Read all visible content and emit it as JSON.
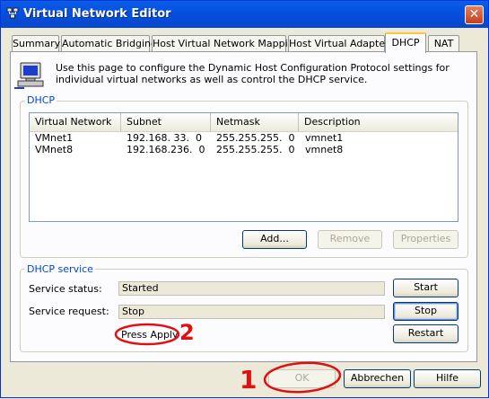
{
  "window": {
    "title": "Virtual Network Editor",
    "close_glyph": "✕"
  },
  "tabs": [
    {
      "label": "Summary"
    },
    {
      "label": "Automatic Bridging"
    },
    {
      "label": "Host Virtual Network Mapping"
    },
    {
      "label": "Host Virtual Adapters"
    },
    {
      "label": "DHCP",
      "active": true
    },
    {
      "label": "NAT"
    }
  ],
  "info": {
    "icon": "network-computer-icon",
    "text": "Use this page to configure the Dynamic Host Configuration Protocol settings for individual virtual networks as well as control the DHCP service."
  },
  "dhcp_group": {
    "label": "DHCP",
    "columns": [
      "Virtual Network",
      "Subnet",
      "Netmask",
      "Description"
    ],
    "rows": [
      [
        "VMnet1",
        "192.168. 33.  0",
        "255.255.255.  0",
        "vmnet1"
      ],
      [
        "VMnet8",
        "192.168.236.  0",
        "255.255.255.  0",
        "vmnet8"
      ]
    ],
    "add_label": "Add...",
    "remove_label": "Remove",
    "properties_label": "Properties"
  },
  "service_group": {
    "label": "DHCP service",
    "status_label": "Service status:",
    "status_value": "Started",
    "request_label": "Service request:",
    "request_value": "Stop",
    "pending_text": "Press Apply",
    "start_label": "Start",
    "stop_label": "Stop",
    "restart_label": "Restart"
  },
  "footer": {
    "ok_label": "OK",
    "cancel_label": "Abbrechen",
    "help_label": "Hilfe"
  },
  "annotations": {
    "one": "1",
    "two": "2",
    "color": "#e01010"
  }
}
